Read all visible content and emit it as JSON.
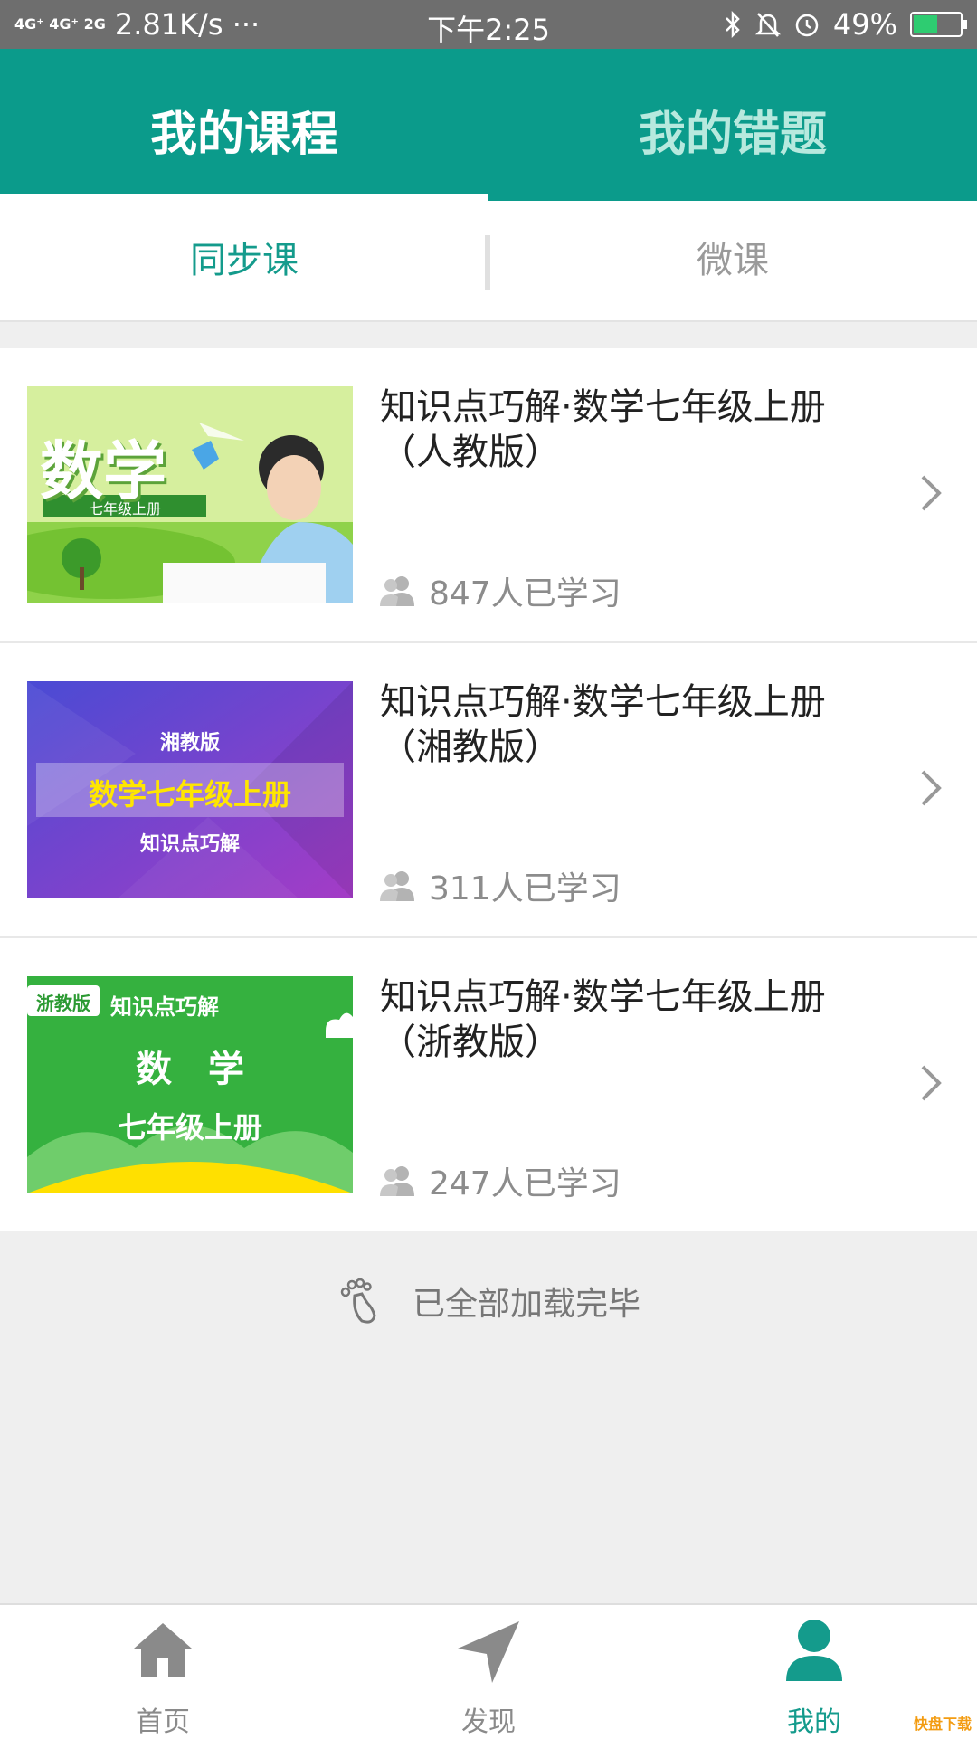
{
  "status_bar": {
    "network": "4G⁺ 4G⁺ 2G",
    "speed": "2.81K/s ···",
    "time": "下午2:25",
    "battery": "49%",
    "battery_level": 0.49,
    "icons": [
      "bluetooth-icon",
      "bell-off-icon",
      "alarm-icon",
      "battery-icon"
    ]
  },
  "top_tabs": [
    {
      "label": "我的课程",
      "active": true
    },
    {
      "label": "我的错题",
      "active": false
    }
  ],
  "sub_tabs": [
    {
      "label": "同步课",
      "active": true
    },
    {
      "label": "微课",
      "active": false
    }
  ],
  "courses": [
    {
      "title": "知识点巧解·数学七年级上册（人教版）",
      "learners": "847人已学习",
      "thumb": {
        "big": "数学",
        "ribbon": "七年级上册"
      }
    },
    {
      "title": "知识点巧解·数学七年级上册（湘教版）",
      "learners": "311人已学习",
      "thumb": {
        "line1": "湘教版",
        "line2": "数学七年级上册",
        "line3": "知识点巧解"
      }
    },
    {
      "title": "知识点巧解·数学七年级上册（浙教版）",
      "learners": "247人已学习",
      "thumb": {
        "badge": "浙教版",
        "line1": "知识点巧解",
        "line2": "数　学",
        "line3": "七年级上册"
      }
    }
  ],
  "list_footer": "已全部加载完毕",
  "bottom_nav": [
    {
      "label": "首页",
      "icon": "home-icon",
      "active": false
    },
    {
      "label": "发现",
      "icon": "navigation-icon",
      "active": false
    },
    {
      "label": "我的",
      "icon": "user-icon",
      "active": true
    }
  ],
  "colors": {
    "primary": "#0b9b8b",
    "accent_text": "#149b8c"
  },
  "watermark": "快盘下载"
}
